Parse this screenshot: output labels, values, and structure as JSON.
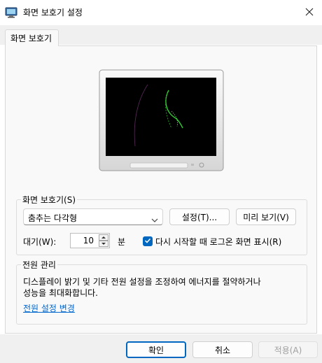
{
  "window": {
    "title": "화면 보호기 설정",
    "app_icon": "monitor-app-icon",
    "close_icon": "close-icon"
  },
  "tabs": [
    {
      "label": "화면 보호기"
    }
  ],
  "screensaver": {
    "group_label": "화면 보호기(S)",
    "selected": "춤추는 다각형",
    "settings_button": "설정(T)...",
    "preview_button": "미리 보기(V)",
    "wait_label": "대기(W):",
    "wait_value": "10",
    "wait_unit": "분",
    "resume_checkbox_label": "다시 시작할 때 로그온 화면 표시(R)",
    "resume_checked": true
  },
  "power": {
    "group_label": "전원 관리",
    "description_line1": "디스플레이 밝기 및 기타 전원 설정을 조정하여 에너지를 절약하거나",
    "description_line2": "성능을 최대화합니다.",
    "link": "전원 설정 변경"
  },
  "buttons": {
    "ok": "확인",
    "cancel": "취소",
    "apply": "적용(A)"
  },
  "colors": {
    "accent": "#0067c0",
    "link": "#0066cc",
    "preview_glow": "#33cc33"
  }
}
